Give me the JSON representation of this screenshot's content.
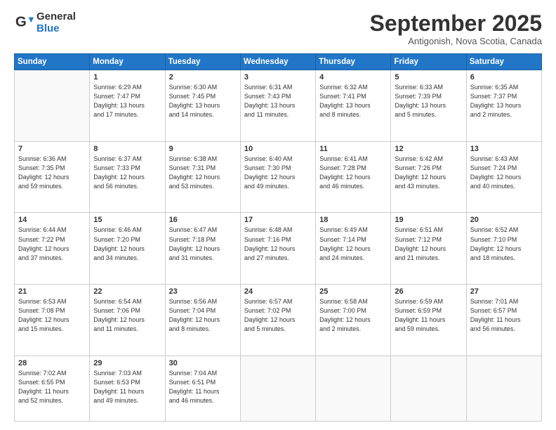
{
  "logo": {
    "general": "General",
    "blue": "Blue"
  },
  "header": {
    "month": "September 2025",
    "location": "Antigonish, Nova Scotia, Canada"
  },
  "days": [
    "Sunday",
    "Monday",
    "Tuesday",
    "Wednesday",
    "Thursday",
    "Friday",
    "Saturday"
  ],
  "weeks": [
    [
      {
        "day": "",
        "content": ""
      },
      {
        "day": "1",
        "content": "Sunrise: 6:29 AM\nSunset: 7:47 PM\nDaylight: 13 hours\nand 17 minutes."
      },
      {
        "day": "2",
        "content": "Sunrise: 6:30 AM\nSunset: 7:45 PM\nDaylight: 13 hours\nand 14 minutes."
      },
      {
        "day": "3",
        "content": "Sunrise: 6:31 AM\nSunset: 7:43 PM\nDaylight: 13 hours\nand 11 minutes."
      },
      {
        "day": "4",
        "content": "Sunrise: 6:32 AM\nSunset: 7:41 PM\nDaylight: 13 hours\nand 8 minutes."
      },
      {
        "day": "5",
        "content": "Sunrise: 6:33 AM\nSunset: 7:39 PM\nDaylight: 13 hours\nand 5 minutes."
      },
      {
        "day": "6",
        "content": "Sunrise: 6:35 AM\nSunset: 7:37 PM\nDaylight: 13 hours\nand 2 minutes."
      }
    ],
    [
      {
        "day": "7",
        "content": "Sunrise: 6:36 AM\nSunset: 7:35 PM\nDaylight: 12 hours\nand 59 minutes."
      },
      {
        "day": "8",
        "content": "Sunrise: 6:37 AM\nSunset: 7:33 PM\nDaylight: 12 hours\nand 56 minutes."
      },
      {
        "day": "9",
        "content": "Sunrise: 6:38 AM\nSunset: 7:31 PM\nDaylight: 12 hours\nand 53 minutes."
      },
      {
        "day": "10",
        "content": "Sunrise: 6:40 AM\nSunset: 7:30 PM\nDaylight: 12 hours\nand 49 minutes."
      },
      {
        "day": "11",
        "content": "Sunrise: 6:41 AM\nSunset: 7:28 PM\nDaylight: 12 hours\nand 46 minutes."
      },
      {
        "day": "12",
        "content": "Sunrise: 6:42 AM\nSunset: 7:26 PM\nDaylight: 12 hours\nand 43 minutes."
      },
      {
        "day": "13",
        "content": "Sunrise: 6:43 AM\nSunset: 7:24 PM\nDaylight: 12 hours\nand 40 minutes."
      }
    ],
    [
      {
        "day": "14",
        "content": "Sunrise: 6:44 AM\nSunset: 7:22 PM\nDaylight: 12 hours\nand 37 minutes."
      },
      {
        "day": "15",
        "content": "Sunrise: 6:46 AM\nSunset: 7:20 PM\nDaylight: 12 hours\nand 34 minutes."
      },
      {
        "day": "16",
        "content": "Sunrise: 6:47 AM\nSunset: 7:18 PM\nDaylight: 12 hours\nand 31 minutes."
      },
      {
        "day": "17",
        "content": "Sunrise: 6:48 AM\nSunset: 7:16 PM\nDaylight: 12 hours\nand 27 minutes."
      },
      {
        "day": "18",
        "content": "Sunrise: 6:49 AM\nSunset: 7:14 PM\nDaylight: 12 hours\nand 24 minutes."
      },
      {
        "day": "19",
        "content": "Sunrise: 6:51 AM\nSunset: 7:12 PM\nDaylight: 12 hours\nand 21 minutes."
      },
      {
        "day": "20",
        "content": "Sunrise: 6:52 AM\nSunset: 7:10 PM\nDaylight: 12 hours\nand 18 minutes."
      }
    ],
    [
      {
        "day": "21",
        "content": "Sunrise: 6:53 AM\nSunset: 7:08 PM\nDaylight: 12 hours\nand 15 minutes."
      },
      {
        "day": "22",
        "content": "Sunrise: 6:54 AM\nSunset: 7:06 PM\nDaylight: 12 hours\nand 11 minutes."
      },
      {
        "day": "23",
        "content": "Sunrise: 6:56 AM\nSunset: 7:04 PM\nDaylight: 12 hours\nand 8 minutes."
      },
      {
        "day": "24",
        "content": "Sunrise: 6:57 AM\nSunset: 7:02 PM\nDaylight: 12 hours\nand 5 minutes."
      },
      {
        "day": "25",
        "content": "Sunrise: 6:58 AM\nSunset: 7:00 PM\nDaylight: 12 hours\nand 2 minutes."
      },
      {
        "day": "26",
        "content": "Sunrise: 6:59 AM\nSunset: 6:59 PM\nDaylight: 11 hours\nand 59 minutes."
      },
      {
        "day": "27",
        "content": "Sunrise: 7:01 AM\nSunset: 6:57 PM\nDaylight: 11 hours\nand 56 minutes."
      }
    ],
    [
      {
        "day": "28",
        "content": "Sunrise: 7:02 AM\nSunset: 6:55 PM\nDaylight: 11 hours\nand 52 minutes."
      },
      {
        "day": "29",
        "content": "Sunrise: 7:03 AM\nSunset: 6:53 PM\nDaylight: 11 hours\nand 49 minutes."
      },
      {
        "day": "30",
        "content": "Sunrise: 7:04 AM\nSunset: 6:51 PM\nDaylight: 11 hours\nand 46 minutes."
      },
      {
        "day": "",
        "content": ""
      },
      {
        "day": "",
        "content": ""
      },
      {
        "day": "",
        "content": ""
      },
      {
        "day": "",
        "content": ""
      }
    ]
  ]
}
